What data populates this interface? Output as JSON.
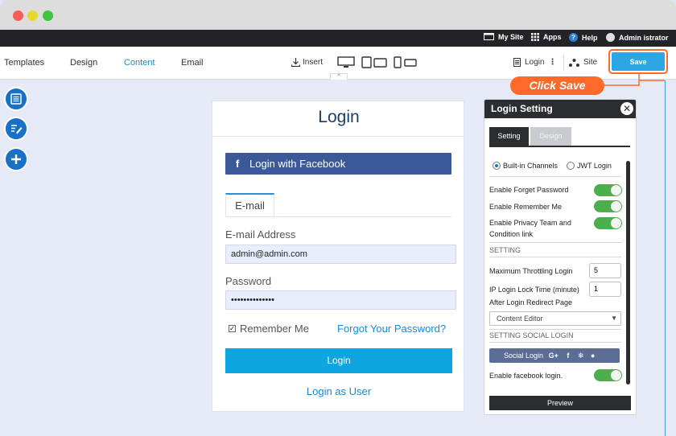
{
  "topnav": {
    "my_site": "My Site",
    "apps": "Apps",
    "help": "Help",
    "user": "Admin istrator"
  },
  "toolbar": {
    "templates": "Templates",
    "design": "Design",
    "content": "Content",
    "email": "Email",
    "insert": "Insert",
    "login_menu": "Login",
    "site": "Site",
    "save": "Save"
  },
  "callout": {
    "text": "Click Save"
  },
  "card": {
    "title": "Login",
    "facebook_button": "Login with Facebook",
    "tab_email": "E-mail",
    "email_label": "E-mail Address",
    "email_value": "admin@admin.com",
    "password_label": "Password",
    "password_value": "••••••••••••••",
    "remember_me": "Remember Me",
    "forgot": "Forgot Your Password?",
    "login_button": "Login",
    "login_as_user": "Login as User"
  },
  "panel": {
    "title": "Login Setting",
    "tab_setting": "Setting",
    "tab_design": "Design",
    "radio_builtin": "Built-in Channels",
    "radio_jwt": "JWT Login",
    "enable_forget": "Enable Forget Password",
    "enable_remember": "Enable Remember Me",
    "enable_privacy_1": "Enable Privacy Team and",
    "enable_privacy_2": "Condition link",
    "setting_heading": "SETTING",
    "max_throttle": "Maximum Throttling Login",
    "max_throttle_value": "5",
    "ip_lock": "IP Login Lock Time (minute)",
    "ip_lock_value": "1",
    "redirect": "After Login Redirect Page",
    "redirect_value": "Content Editor",
    "social_heading": "SETTING SOCIAL LOGIN",
    "social_login": "Social Login",
    "enable_facebook": "Enable facebook login.",
    "preview": "Preview"
  },
  "colors": {
    "accent": "#2ea6e4",
    "callout": "#ff6a2b",
    "facebook": "#3b5998",
    "toggle_on": "#4cae4c"
  }
}
